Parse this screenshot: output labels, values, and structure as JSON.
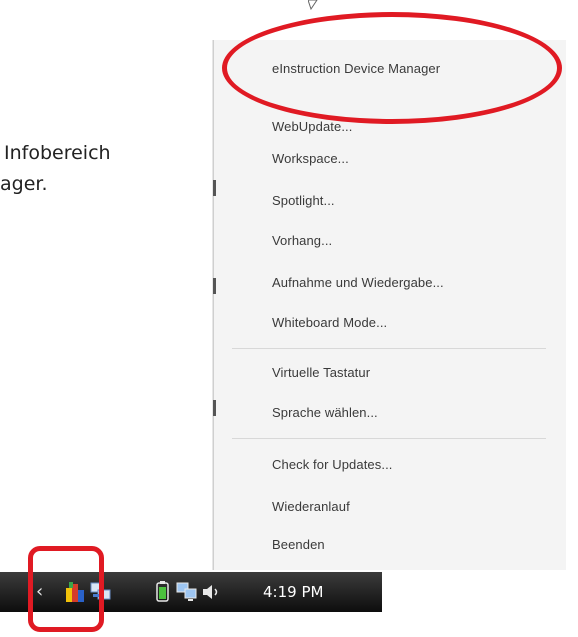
{
  "caption": {
    "line1": "Infobereich",
    "line2": "ager."
  },
  "menu": {
    "items": [
      {
        "label": "eInstruction Device Manager"
      },
      {
        "label": "WebUpdate..."
      },
      {
        "label": "Workspace..."
      },
      {
        "label": "Spotlight..."
      },
      {
        "label": "Vorhang..."
      },
      {
        "label": "Aufnahme und Wiedergabe..."
      },
      {
        "label": "Whiteboard Mode..."
      },
      {
        "label": "Virtuelle Tastatur"
      },
      {
        "label": "Sprache wählen..."
      },
      {
        "label": "Check for Updates..."
      },
      {
        "label": "Wiederanlauf"
      },
      {
        "label": "Beenden"
      }
    ]
  },
  "taskbar": {
    "chevron": "‹",
    "clock": "4:19 PM",
    "icons": [
      "einstruction-tray-icon",
      "network-tray-icon",
      "battery-icon",
      "network-connection-icon",
      "volume-icon"
    ]
  },
  "colors": {
    "highlight": "#e01a23",
    "taskbar": "#1a1a1a",
    "menu_bg": "#f4f4f4"
  }
}
